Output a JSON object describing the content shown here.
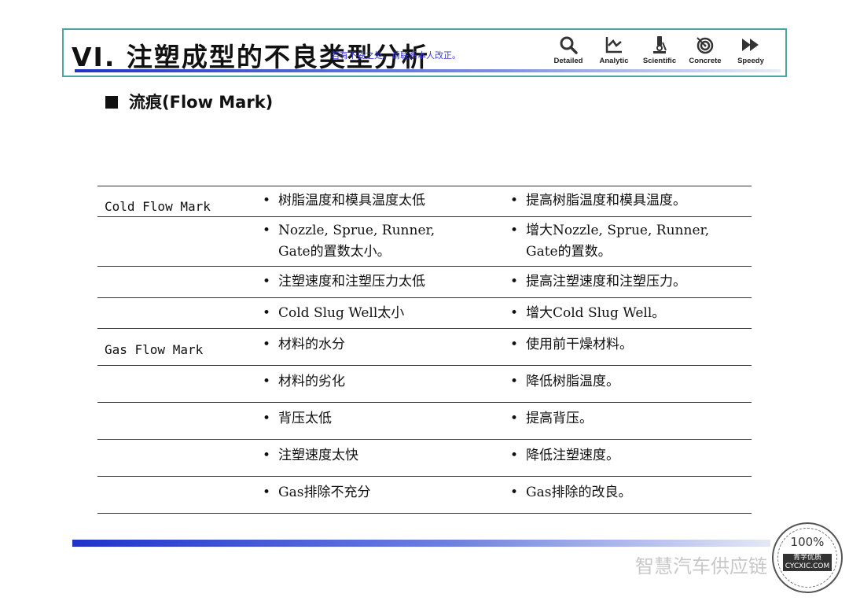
{
  "header": {
    "title": "VI. 注塑成型的不良类型分析",
    "overlay": "若有不妥之处，请联系本人改正。",
    "icons": [
      {
        "icon": "search-icon",
        "label": "Detailed"
      },
      {
        "icon": "chart-icon",
        "label": "Analytic"
      },
      {
        "icon": "microscope-icon",
        "label": "Scientific"
      },
      {
        "icon": "target-icon",
        "label": "Concrete"
      },
      {
        "icon": "fast-forward-icon",
        "label": "Speedy"
      }
    ]
  },
  "subtitle": "流痕(Flow Mark)",
  "table": {
    "rows": [
      {
        "category": "Cold Flow Mark",
        "cause": [
          "树脂温度和模具温度太低"
        ],
        "solution": [
          "提高树脂温度和模具温度。"
        ]
      },
      {
        "category": "",
        "cause": [
          "Nozzle, Sprue, Runner,",
          "Gate的置数太小。"
        ],
        "solution": [
          "增大Nozzle, Sprue, Runner,",
          "Gate的置数。"
        ]
      },
      {
        "category": "",
        "cause": [
          "注塑速度和注塑压力太低"
        ],
        "solution": [
          "提高注塑速度和注塑压力。"
        ]
      },
      {
        "category": "",
        "cause": [
          "Cold Slug Well太小"
        ],
        "solution": [
          "增大Cold Slug Well。"
        ]
      },
      {
        "category": "Gas Flow Mark",
        "cause": [
          "材料的水分"
        ],
        "solution": [
          "使用前干燥材料。"
        ]
      },
      {
        "category": "",
        "cause": [
          "材料的劣化"
        ],
        "solution": [
          "降低树脂温度。"
        ]
      },
      {
        "category": "",
        "cause": [
          "背压太低"
        ],
        "solution": [
          "提高背压。"
        ]
      },
      {
        "category": "",
        "cause": [
          "注塑速度太快"
        ],
        "solution": [
          "降低注塑速度。"
        ]
      },
      {
        "category": "",
        "cause": [
          "Gas排除不充分"
        ],
        "solution": [
          "Gas排除的改良。"
        ]
      }
    ]
  },
  "footer": {
    "watermark": "智慧汽车供应链",
    "seal_text": "100%",
    "seal_band_top": "青学优质",
    "seal_band_bottom": "CYCXIC.COM"
  }
}
